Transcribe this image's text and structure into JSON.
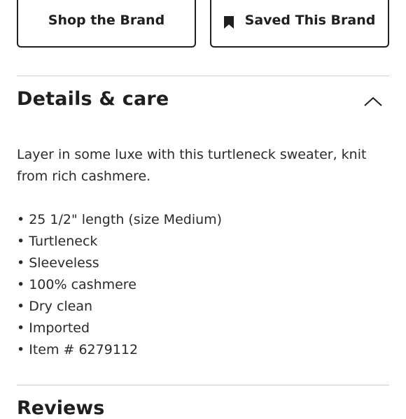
{
  "buttons": {
    "shop_label": "Shop the Brand",
    "saved_label": "Saved This Brand"
  },
  "details": {
    "title": "Details & care",
    "description": "Layer in some luxe with this turtleneck sweater, knit from rich cashmere.",
    "features": [
      "25 1/2\" length (size Medium)",
      "Turtleneck",
      "Sleeveless",
      "100% cashmere",
      "Dry clean",
      "Imported",
      "Item # 6279112"
    ],
    "bullet": "•"
  },
  "next_section": {
    "title_partial": "Reviews"
  },
  "icons": {
    "bookmark": "bookmark-icon",
    "chevron": "chevron-up-icon"
  },
  "colors": {
    "text": "#1f1f1f",
    "divider": "#cfcfcf",
    "background": "#ffffff"
  }
}
